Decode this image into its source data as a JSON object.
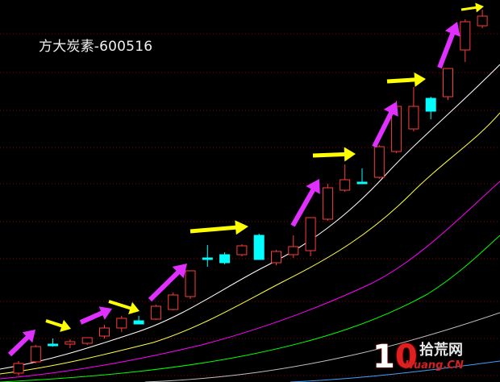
{
  "header": {
    "title": "方大炭素-600516"
  },
  "watermark": {
    "ten": "1",
    "zero": "0",
    "cn": "拾荒网",
    "en": "Huang.CN"
  },
  "colors": {
    "background": "#000000",
    "up_candle": "#ff3a3a",
    "down_candle": "#00ffff",
    "grid": "#8b0000",
    "arrow_yellow": "#ffff00",
    "arrow_magenta": "#e030ff",
    "ma_white": "#ffffff",
    "ma_yellow": "#ffff40",
    "ma_magenta": "#ff00ff",
    "ma_green": "#00ff00",
    "ma_gray": "#c0c0c0",
    "ma_blue": "#40a0ff"
  },
  "chart_data": {
    "type": "candlestick",
    "title": "方大炭素-600516",
    "ylim": [
      0,
      474
    ],
    "grid": "horizontal dotted",
    "candles": [
      {
        "o": 463,
        "h": 466,
        "l": 448,
        "c": 451
      },
      {
        "o": 449,
        "h": 451,
        "l": 428,
        "c": 430
      },
      {
        "o": 427,
        "h": 430,
        "l": 420,
        "c": 427
      },
      {
        "o": 427,
        "h": 432,
        "l": 421,
        "c": 424
      },
      {
        "o": 426,
        "h": 428,
        "l": 419,
        "c": 419
      },
      {
        "o": 417,
        "h": 420,
        "l": 403,
        "c": 407
      },
      {
        "o": 407,
        "h": 412,
        "l": 392,
        "c": 395
      },
      {
        "o": 398,
        "h": 402,
        "l": 392,
        "c": 402
      },
      {
        "o": 396,
        "h": 397,
        "l": 378,
        "c": 380
      },
      {
        "o": 384,
        "h": 385,
        "l": 363,
        "c": 366
      },
      {
        "o": 368,
        "h": 371,
        "l": 336,
        "c": 336
      },
      {
        "o": 320,
        "h": 331,
        "l": 304,
        "c": 320
      },
      {
        "o": 316,
        "h": 328,
        "l": 313,
        "c": 326
      },
      {
        "o": 316,
        "h": 318,
        "l": 303,
        "c": 305
      },
      {
        "o": 292,
        "h": 322,
        "l": 290,
        "c": 322
      },
      {
        "o": 326,
        "h": 329,
        "l": 310,
        "c": 312
      },
      {
        "o": 316,
        "h": 320,
        "l": 292,
        "c": 306
      },
      {
        "o": 311,
        "h": 318,
        "l": 270,
        "c": 270
      },
      {
        "o": 272,
        "h": 274,
        "l": 228,
        "c": 233
      },
      {
        "o": 236,
        "h": 238,
        "l": 204,
        "c": 223
      },
      {
        "o": 226,
        "h": 227,
        "l": 209,
        "c": 226
      },
      {
        "o": 220,
        "h": 222,
        "l": 180,
        "c": 182
      },
      {
        "o": 188,
        "h": 190,
        "l": 125,
        "c": 132
      },
      {
        "o": 160,
        "h": 163,
        "l": 108,
        "c": 132
      },
      {
        "o": 122,
        "h": 148,
        "l": 120,
        "c": 138
      },
      {
        "o": 120,
        "h": 124,
        "l": 85,
        "c": 85
      },
      {
        "o": 62,
        "h": 77,
        "l": 24,
        "c": 27
      },
      {
        "o": 32,
        "h": 35,
        "l": 12,
        "c": 20
      }
    ]
  }
}
